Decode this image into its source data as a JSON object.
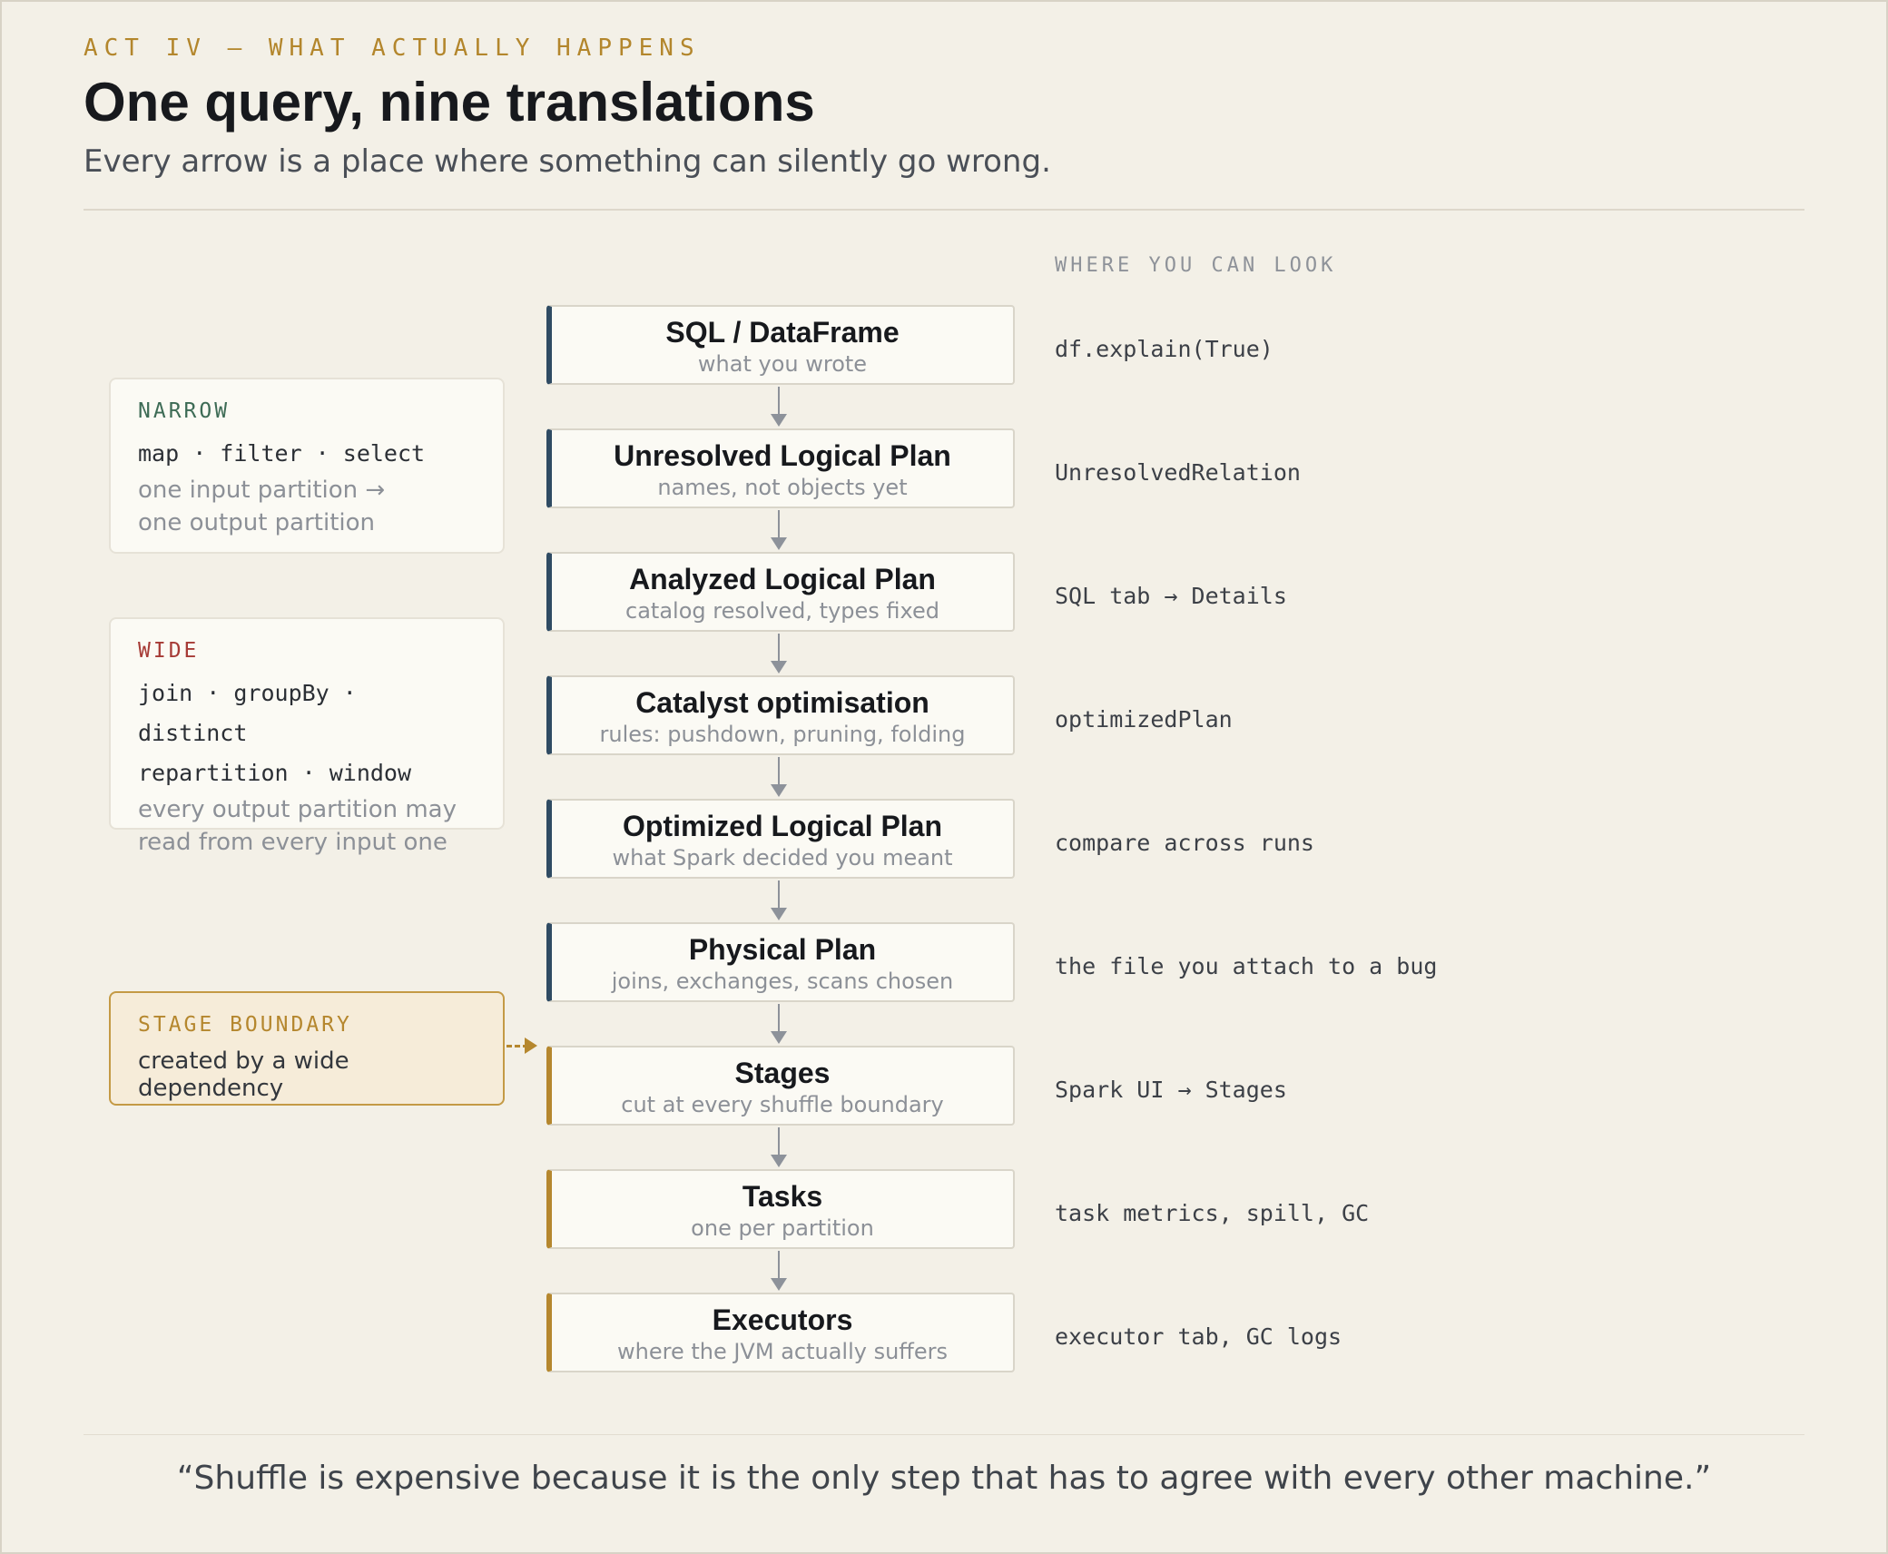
{
  "header": {
    "kicker": "ACT IV — WHAT ACTUALLY HAPPENS",
    "title": "One query, nine translations",
    "subtitle": "Every arrow is a place where something can silently go wrong."
  },
  "look_heading": "WHERE YOU CAN LOOK",
  "steps": [
    {
      "title": "SQL / DataFrame",
      "sub": "what you wrote",
      "look": "df.explain(True)"
    },
    {
      "title": "Unresolved Logical Plan",
      "sub": "names, not objects yet",
      "look": "UnresolvedRelation"
    },
    {
      "title": "Analyzed Logical Plan",
      "sub": "catalog resolved, types fixed",
      "look": "SQL tab → Details"
    },
    {
      "title": "Catalyst optimisation",
      "sub": "rules: pushdown, pruning, folding",
      "look": "optimizedPlan"
    },
    {
      "title": "Optimized Logical Plan",
      "sub": "what Spark decided you meant",
      "look": "compare across runs"
    },
    {
      "title": "Physical Plan",
      "sub": "joins, exchanges, scans chosen",
      "look": "the file you attach to a bug"
    },
    {
      "title": "Stages",
      "sub": "cut at every shuffle boundary",
      "look": "Spark UI → Stages"
    },
    {
      "title": "Tasks",
      "sub": "one per partition",
      "look": "task metrics, spill, GC"
    },
    {
      "title": "Executors",
      "sub": "where the JVM actually suffers",
      "look": "executor tab, GC logs"
    }
  ],
  "narrow": {
    "label": "NARROW",
    "ops": [
      "map · filter · select"
    ],
    "note": [
      "one input partition →",
      "one output partition"
    ]
  },
  "wide": {
    "label": "WIDE",
    "ops": [
      "join · groupBy · distinct",
      "repartition · window"
    ],
    "note": [
      "every output partition may",
      "read from every input one"
    ]
  },
  "stage_boundary": {
    "label": "STAGE BOUNDARY",
    "text": "created by a wide dependency"
  },
  "quote": "“Shuffle is expensive because it is the only step that has to agree with every other machine.”",
  "colors": {
    "background": "#f3f0e7",
    "accent_gold": "#b5872e",
    "accent_blue": "#2f4b63",
    "narrow_label": "#3d6b55",
    "wide_label": "#a63a35"
  }
}
